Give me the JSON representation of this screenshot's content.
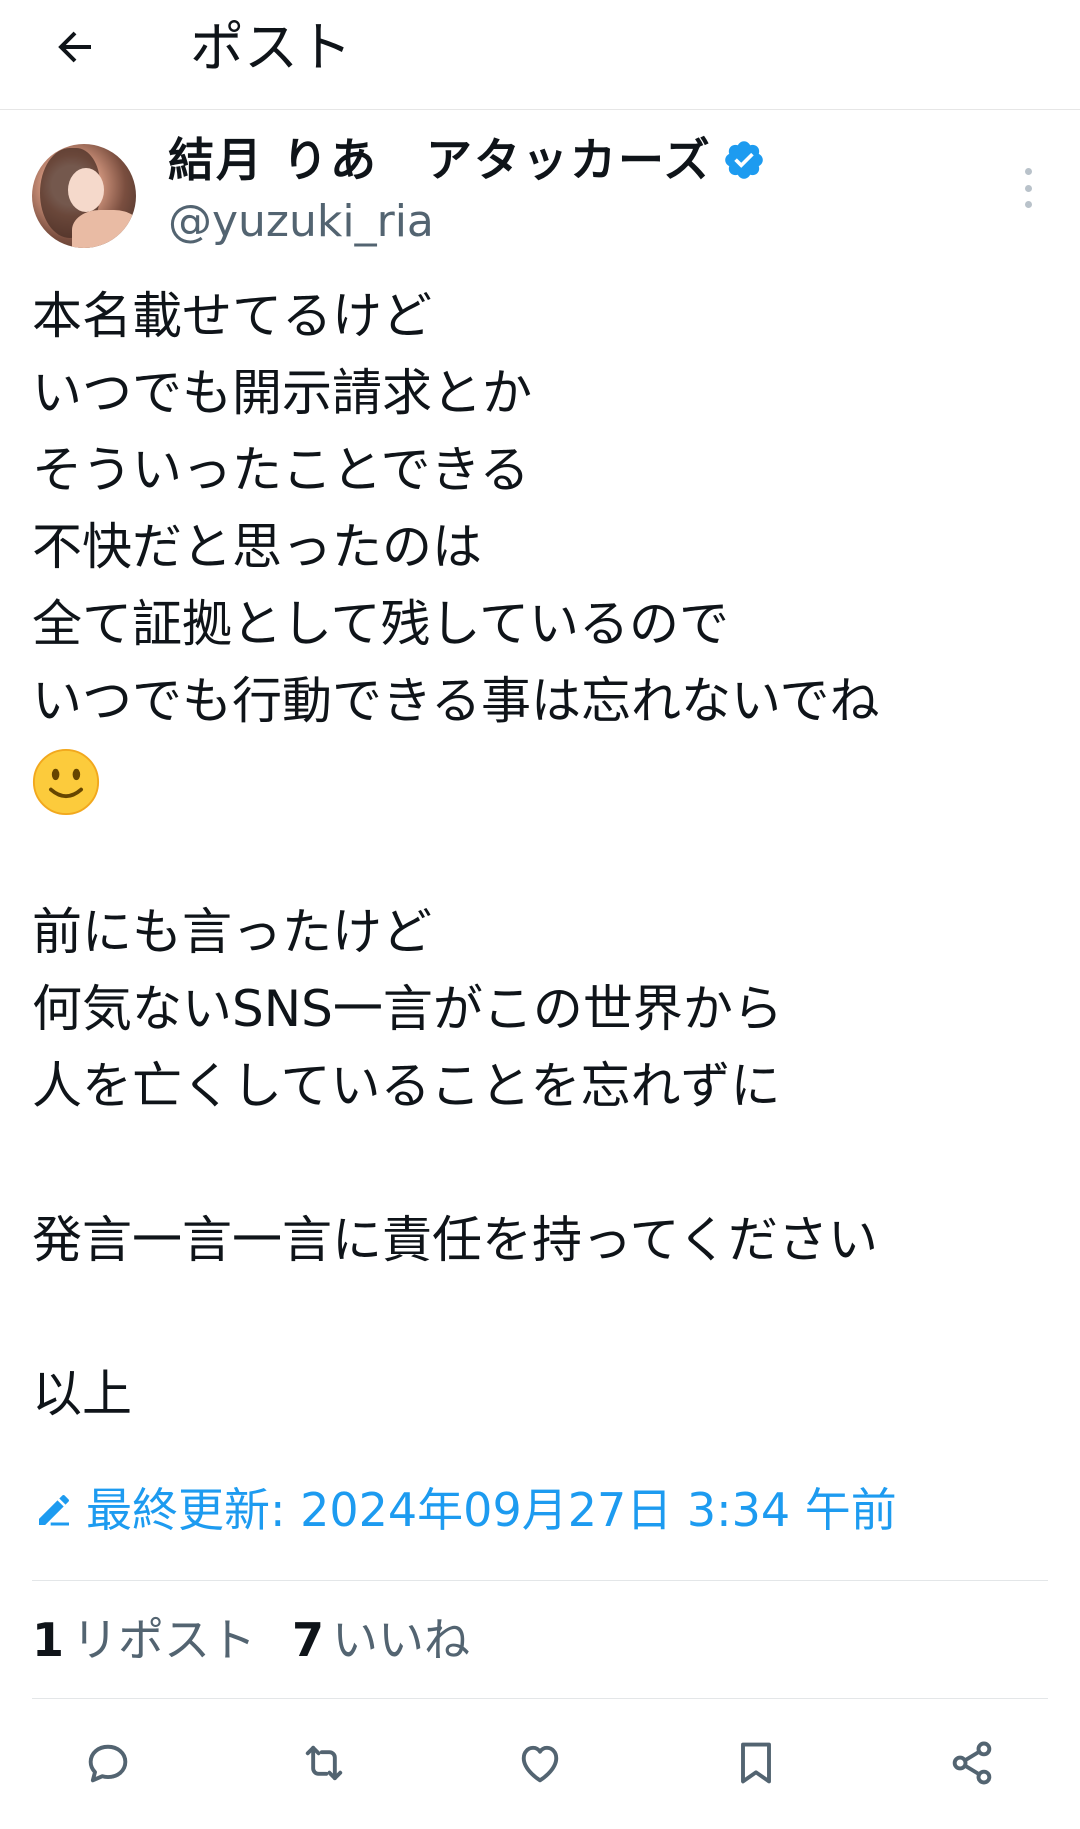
{
  "header": {
    "title": "ポスト",
    "back_icon": "arrow-left-icon"
  },
  "author": {
    "display_name": "結月 りあ　アタッカーズ",
    "handle": "@yuzuki_ria",
    "verified": true,
    "verified_color": "#1d9bf0"
  },
  "tweet": {
    "part1": "本名載せてるけど\nいつでも開示請求とか\nそういったことできる\n不快だと思ったのは\n全て証拠として残しているので\nいつでも行動できる事は忘れないでね\n",
    "emoji": "slightly-smiling-face",
    "part2": "\n\n前にも言ったけど\n何気ないSNS一言がこの世界から\n人を亡くしていることを忘れずに\n\n発言一言一言に責任を持ってください\n\n以上"
  },
  "edited": {
    "text": "最終更新: 2024年09月27日 3:34 午前",
    "icon": "pencil-icon",
    "color": "#1d9bf0"
  },
  "stats": {
    "reposts_count": "1",
    "reposts_label": "リポスト",
    "likes_count": "7",
    "likes_label": "いいね"
  },
  "actions": [
    "reply-icon",
    "repost-icon",
    "like-icon",
    "bookmark-icon",
    "share-icon"
  ]
}
